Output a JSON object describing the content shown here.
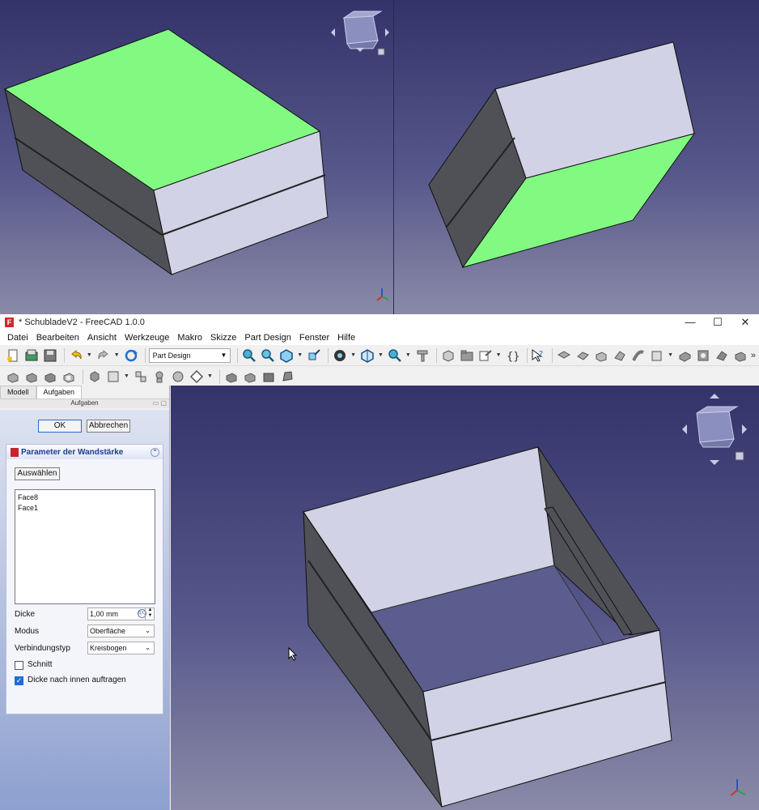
{
  "app": {
    "title": "* SchubladeV2 - FreeCAD 1.0.0",
    "logo": "F",
    "window_controls": [
      "—",
      "☐",
      "✕"
    ]
  },
  "menu": [
    "Datei",
    "Bearbeiten",
    "Ansicht",
    "Werkzeuge",
    "Makro",
    "Skizze",
    "Part Design",
    "Fenster",
    "Hilfe"
  ],
  "toolbar": {
    "workbench_selector": "Part Design",
    "overflow": "»"
  },
  "panel": {
    "tabs": [
      "Modell",
      "Aufgaben"
    ],
    "title": "Aufgaben",
    "ok_label": "OK",
    "cancel_label": "Abbrechen",
    "group_title": "Parameter der Wandstärke",
    "select_label": "Auswählen",
    "faces": [
      "Face8",
      "Face1"
    ],
    "thickness_label": "Dicke",
    "thickness_value": "1,00 mm",
    "mode_label": "Modus",
    "mode_value": "Oberfläche",
    "join_label": "Verbindungstyp",
    "join_value": "Kreisbogen",
    "cut_label": "Schnitt",
    "cut_checked": false,
    "inward_label": "Dicke nach innen auftragen",
    "inward_checked": true
  },
  "colors": {
    "selected_face": "#82fa82",
    "face_light": "#d2d2e6",
    "face_dark": "#505057",
    "accent": "#1f6fd0"
  },
  "icons": [
    "new-file-icon",
    "open-file-icon",
    "save-icon",
    "undo-icon",
    "redo-icon",
    "refresh-icon",
    "zoom-fit-icon",
    "zoom-icon",
    "view-cube-icon",
    "sketch-icon",
    "draw-style-icon",
    "std-views-icon",
    "measure-icon",
    "whats-this-icon",
    "navigation-cube-icon",
    "axis-cross-icon"
  ]
}
